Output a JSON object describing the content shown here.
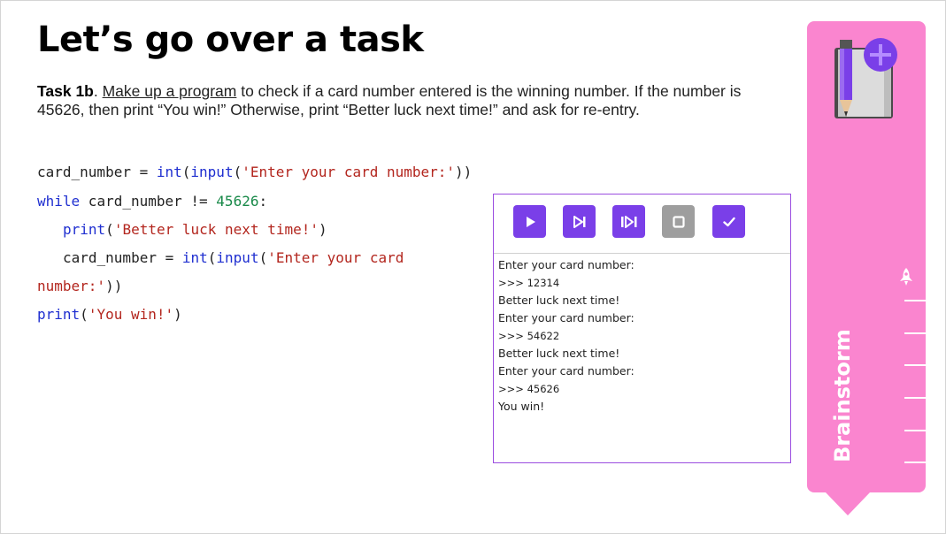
{
  "slide": {
    "title": "Let’s go over a task",
    "task_label": "Task 1b",
    "task_sep": ". ",
    "task_link": "Make up a program",
    "task_text": " to check if a card number entered is the winning number. If the number is 45626, then print “You win!” Otherwise, print “Better luck next time!” and ask for re-entry."
  },
  "code": {
    "l1_a": "card_number = ",
    "l1_int": "int",
    "l1_b": "(",
    "l1_input": "input",
    "l1_c": "(",
    "l1_str": "'Enter your card number:'",
    "l1_d": "))",
    "l2_while": "while",
    "l2_a": " card_number != ",
    "l2_num": "45626",
    "l2_b": ":",
    "l3_print": "print",
    "l3_a": "(",
    "l3_str": "'Better luck next time!'",
    "l3_b": ")",
    "l4_a": "card_number = ",
    "l4_int": "int",
    "l4_b": "(",
    "l4_input": "input",
    "l4_c": "(",
    "l4_str": "'Enter your card",
    "l5_str": "number:'",
    "l5_a": "))",
    "l6_print": "print",
    "l6_a": "(",
    "l6_str": "'You win!'",
    "l6_b": ")"
  },
  "console": {
    "buttons": [
      "run-icon",
      "step-icon",
      "step-over-icon",
      "stop-icon",
      "check-icon"
    ],
    "colors": {
      "accent": "#7a3fe8",
      "disabled": "#9e9e9e",
      "border": "#9b4de0"
    },
    "lines": [
      "Enter your card number:",
      ">>> 12314",
      "Better luck next time!",
      "Enter your card number:",
      ">>> 54622",
      "Better luck next time!",
      "Enter your card number:",
      ">>> 45626",
      "You win!"
    ]
  },
  "sidebar": {
    "label": "Brainstorm",
    "color": "#fa85cf",
    "icons": [
      "notebook-pencil-plus-icon",
      "rocket-icon"
    ]
  }
}
